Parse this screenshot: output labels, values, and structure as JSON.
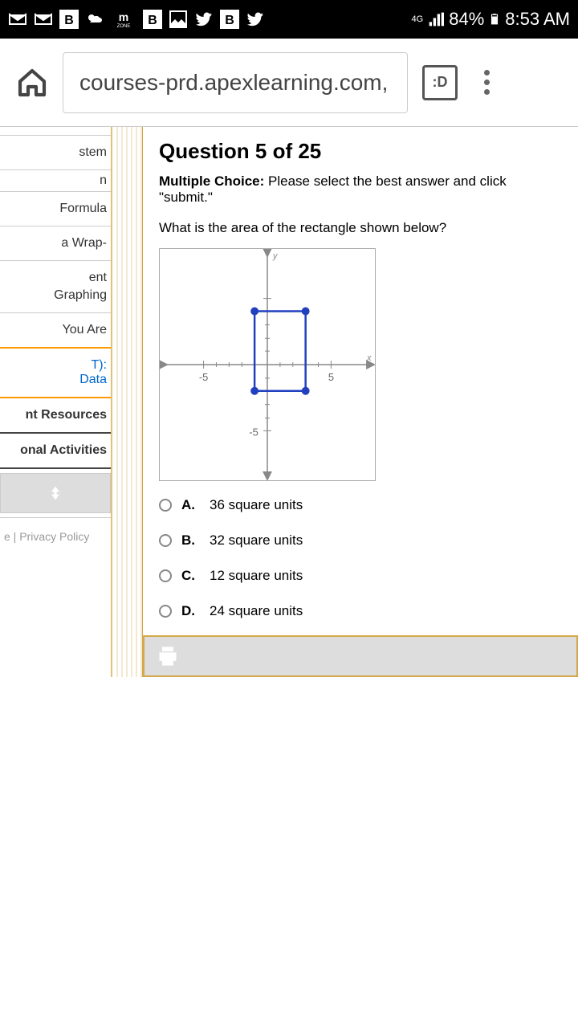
{
  "status": {
    "battery": "84%",
    "time": "8:53 AM",
    "network": "4G"
  },
  "browser": {
    "url": "courses-prd.apexlearning.com,",
    "tab_indicator": ":D"
  },
  "sidebar": {
    "items": [
      {
        "label": "stem"
      },
      {
        "label": "n"
      },
      {
        "label": "Formula"
      },
      {
        "label": "a Wrap-"
      },
      {
        "label": "ent"
      },
      {
        "label": "Graphing"
      },
      {
        "label": "You Are"
      },
      {
        "label": "T):"
      },
      {
        "label": "Data"
      },
      {
        "label": "nt Resources"
      },
      {
        "label": "onal Activities"
      }
    ],
    "footer": "e  |  Privacy Policy"
  },
  "question": {
    "title": "Question 5 of 25",
    "type_label": "Multiple Choice:",
    "instructions": " Please select the best answer and click \"submit.\"",
    "prompt": "What is the area of the rectangle shown below?",
    "choices": [
      {
        "letter": "A.",
        "text": "36 square units"
      },
      {
        "letter": "B.",
        "text": "32 square units"
      },
      {
        "letter": "C.",
        "text": "12 square units"
      },
      {
        "letter": "D.",
        "text": "24 square units"
      }
    ]
  },
  "chart_data": {
    "type": "scatter",
    "title": "",
    "xlabel": "x",
    "ylabel": "y",
    "xlim": [
      -8,
      8
    ],
    "ylim": [
      -8,
      8
    ],
    "tick_labels_x": [
      -5,
      5
    ],
    "tick_labels_y": [
      -5
    ],
    "rectangle_vertices": [
      {
        "x": -1,
        "y": 4
      },
      {
        "x": 3,
        "y": 4
      },
      {
        "x": 3,
        "y": -2
      },
      {
        "x": -1,
        "y": -2
      }
    ]
  }
}
